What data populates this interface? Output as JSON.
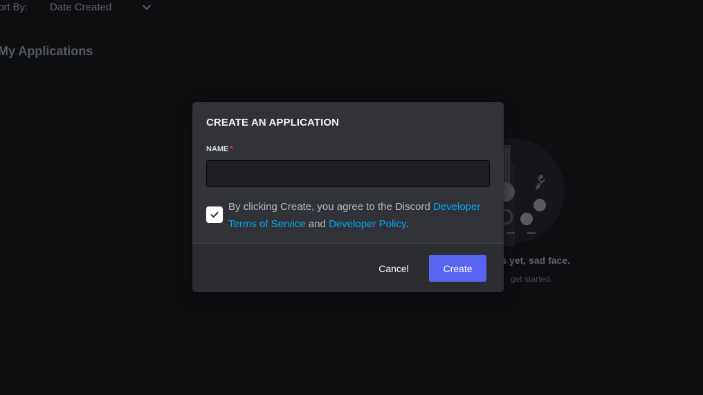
{
  "background": {
    "sort_label": "ort By:",
    "sort_value": "Date Created",
    "section_title": "My Applications",
    "empty_title": "s yet, sad face.",
    "empty_subtitle": "get started."
  },
  "modal": {
    "title": "CREATE AN APPLICATION",
    "name_label": "NAME",
    "required_mark": "*",
    "name_value": "",
    "terms_checked": true,
    "agree_prefix": "By clicking Create, you agree to the Discord ",
    "terms_link": "Developer Terms of Service",
    "agree_middle": " and ",
    "policy_link": "Developer Policy",
    "agree_suffix": ".",
    "cancel_label": "Cancel",
    "create_label": "Create"
  },
  "colors": {
    "accent": "#5865f2",
    "link": "#00a8fc",
    "modal_bg": "#313338",
    "footer_bg": "#2b2d31",
    "required": "#f23f43"
  },
  "icons": {
    "sort_chevron": "chevron-down-icon",
    "checkbox_mark": "checkmark-icon"
  }
}
